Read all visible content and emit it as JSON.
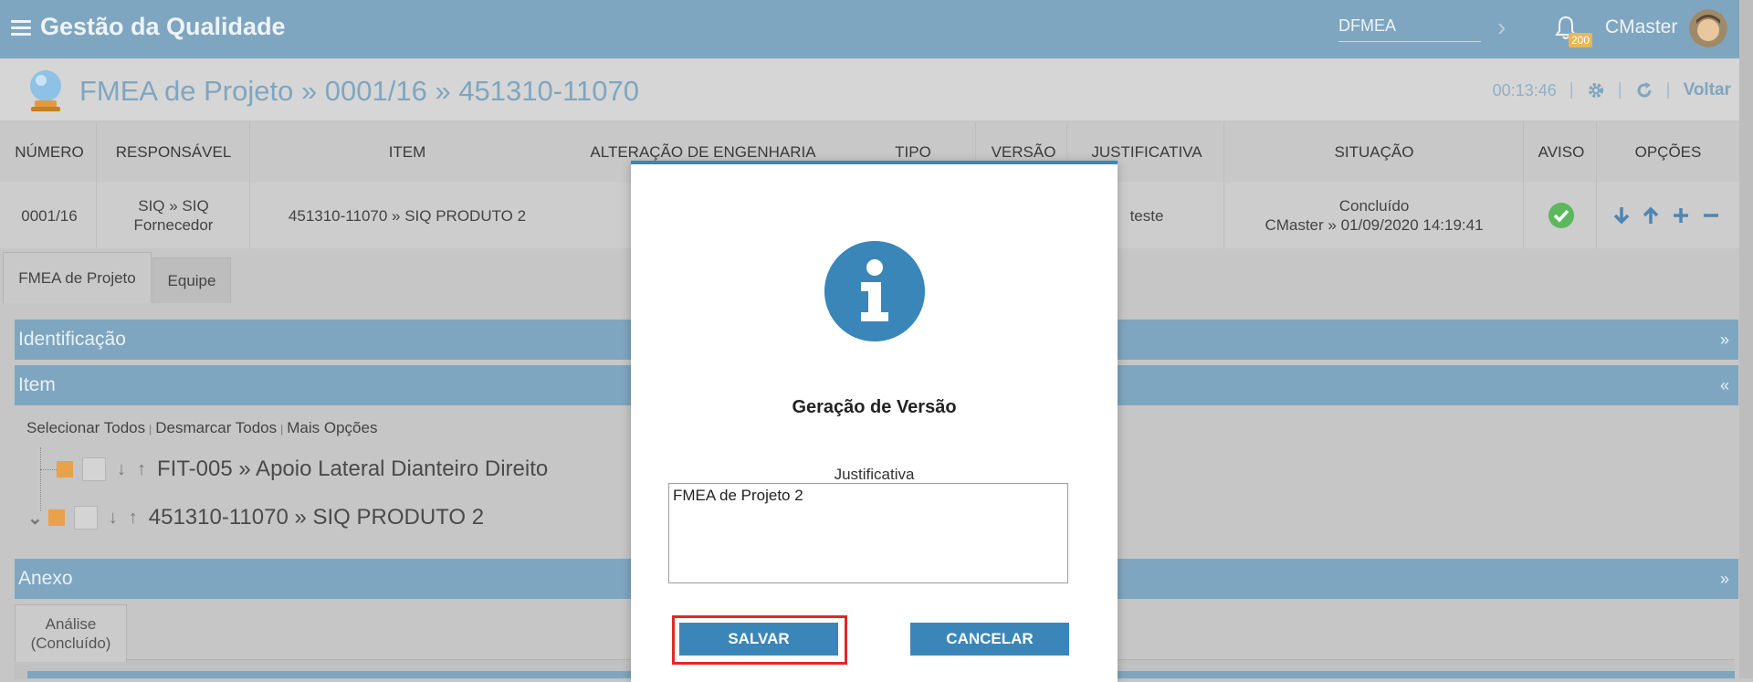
{
  "app": {
    "title": "Gestão da Qualidade"
  },
  "header": {
    "module_value": "DFMEA",
    "notifications": "200",
    "user": "CMaster"
  },
  "page": {
    "title": "FMEA de Projeto » 0001/16 » 451310-11070",
    "timer": "00:13:46",
    "back": "Voltar"
  },
  "table": {
    "headers": [
      "NÚMERO",
      "RESPONSÁVEL",
      "ITEM",
      "ALTERAÇÃO DE ENGENHARIA",
      "TIPO",
      "VERSÃO",
      "JUSTIFICATIVA",
      "SITUAÇÃO",
      "AVISO",
      "OPÇÕES"
    ],
    "row": {
      "numero": "0001/16",
      "responsavel_1": "SIQ » SIQ",
      "responsavel_2": "Fornecedor",
      "item": "451310-11070 » SIQ PRODUTO 2",
      "justificativa": "teste",
      "situacao_1": "Concluído",
      "situacao_2": "CMaster » 01/09/2020 14:19:41"
    }
  },
  "tabs": [
    "FMEA de Projeto",
    "Equipe"
  ],
  "sections": {
    "identificacao": "Identificação",
    "item": "Item",
    "anexo": "Anexo"
  },
  "item_links": [
    "Selecionar Todos",
    "Desmarcar Todos",
    "Mais Opções"
  ],
  "tree": [
    "FIT-005 » Apoio Lateral Dianteiro Direito",
    "451310-11070 » SIQ PRODUTO 2"
  ],
  "subtab": {
    "line1": "Análise",
    "line2": "(Concluído)"
  },
  "dialog": {
    "title": "Geração de Versão",
    "field_label": "Justificativa",
    "field_value": "FMEA de Projeto 2",
    "save": "SALVAR",
    "cancel": "CANCELAR"
  },
  "colors": {
    "header": "#7fa6c0",
    "primary": "#3a86b8",
    "highlight": "#e32727",
    "ok": "#5cb85c"
  }
}
